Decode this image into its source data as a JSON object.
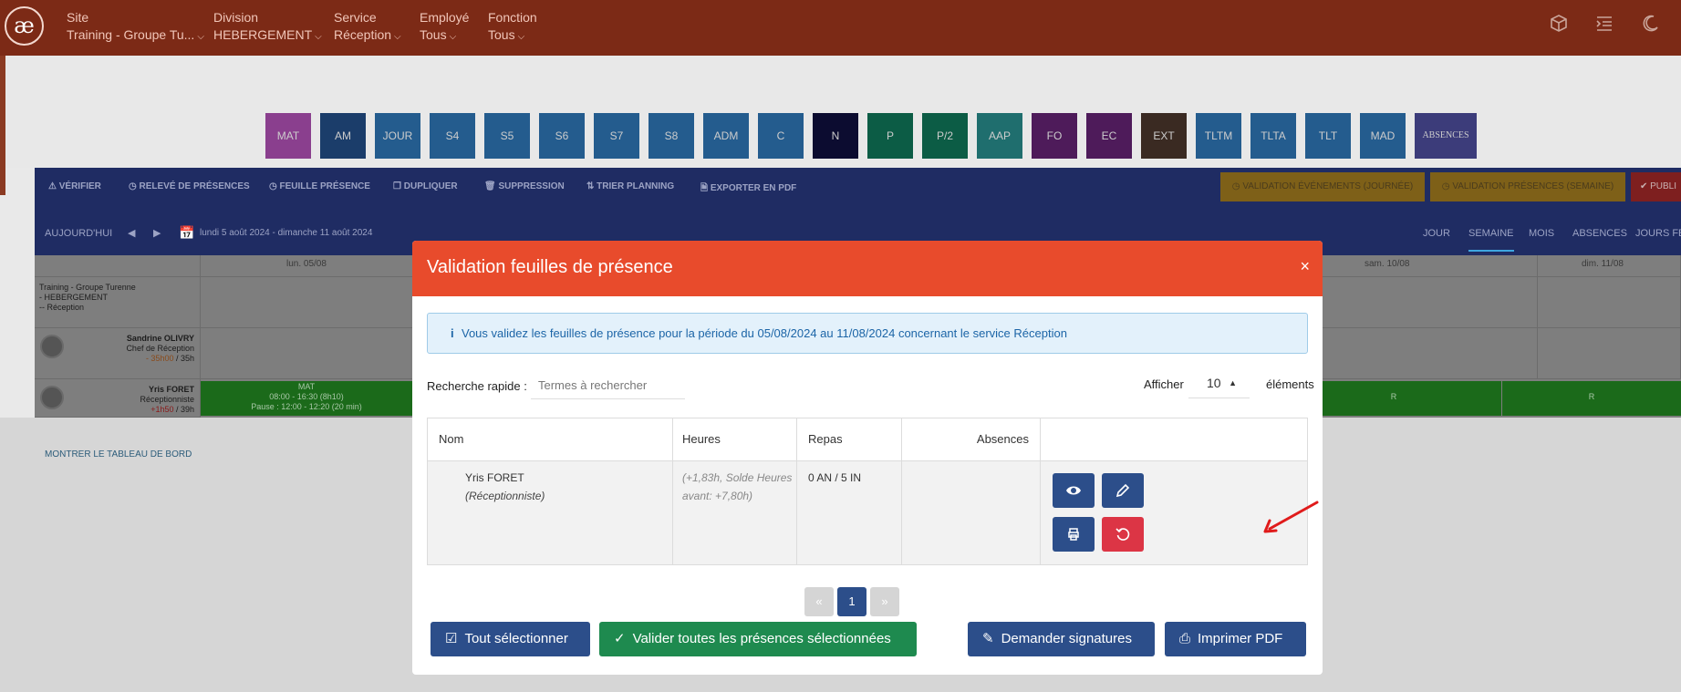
{
  "topbar": {
    "logo": "æ",
    "filters": [
      {
        "label": "Site",
        "value": "Training - Groupe Tu..."
      },
      {
        "label": "Division",
        "value": "HEBERGEMENT"
      },
      {
        "label": "Service",
        "value": "Réception"
      },
      {
        "label": "Employé",
        "value": "Tous"
      },
      {
        "label": "Fonction",
        "value": "Tous"
      }
    ],
    "icons": [
      "cube-icon",
      "indent-icon",
      "moon-icon"
    ]
  },
  "codes": [
    {
      "label": "MAT",
      "color": "#8a3f8e"
    },
    {
      "label": "AM",
      "color": "#1b3d6a"
    },
    {
      "label": "JOUR",
      "color": "#245c8e"
    },
    {
      "label": "S4",
      "color": "#245c8e"
    },
    {
      "label": "S5",
      "color": "#245c8e"
    },
    {
      "label": "S6",
      "color": "#245c8e"
    },
    {
      "label": "S7",
      "color": "#245c8e"
    },
    {
      "label": "S8",
      "color": "#245c8e"
    },
    {
      "label": "ADM",
      "color": "#245c8e"
    },
    {
      "label": "C",
      "color": "#245c8e"
    },
    {
      "label": "N",
      "color": "#0c0c30"
    },
    {
      "label": "P",
      "color": "#0c5c45"
    },
    {
      "label": "P/2",
      "color": "#0c5c45"
    },
    {
      "label": "AAP",
      "color": "#1f6e6e"
    },
    {
      "label": "FO",
      "color": "#4e1b5a"
    },
    {
      "label": "EC",
      "color": "#4e1b5a"
    },
    {
      "label": "EXT",
      "color": "#3a2a22"
    },
    {
      "label": "TLTM",
      "color": "#245c8e"
    },
    {
      "label": "TLTA",
      "color": "#245c8e"
    },
    {
      "label": "TLT",
      "color": "#245c8e"
    },
    {
      "label": "MAD",
      "color": "#245c8e"
    },
    {
      "label": "ABSENCES",
      "color": "#3c3c7a"
    }
  ],
  "actions": [
    "VÉRIFIER",
    "RELEVÉ DE PRÉSENCES",
    "FEUILLE PRÉSENCE",
    "DUPLIQUER",
    "SUPPRESSION",
    "TRIER PLANNING",
    "EXPORTER EN PDF"
  ],
  "action_buttons": [
    "VALIDATION ÉVÉNEMENTS (JOURNÉE)",
    "VALIDATION PRÉSENCES (SEMAINE)",
    "PUBLI"
  ],
  "nav": {
    "today": "AUJOURD'HUI",
    "date_range": "lundi 5 août 2024 - dimanche 11 août 2024",
    "tabs": [
      "JOUR",
      "SEMAINE",
      "MOIS",
      "ABSENCES",
      "JOURS FÉ"
    ]
  },
  "planning": {
    "days": [
      "lun. 05/08",
      "sam. 10/08",
      "dim. 11/08"
    ],
    "group_label": "Training - Groupe Turenne\n- HEBERGEMENT\n-- Réception",
    "employees": [
      {
        "name": "Sandrine OLIVRY",
        "role": "Chef de Réception",
        "hours_delta": "- 35h00",
        "hours_total": " / 35h"
      },
      {
        "name": "Yris FORET",
        "role": "Réceptionniste",
        "hours_delta": "+1h50",
        "hours_total": " / 39h"
      }
    ],
    "shift": {
      "code": "MAT",
      "time": "08:00 - 16:30 (8h10)",
      "pause": "Pause : 12:00 - 12:20 (20 min)"
    },
    "rest_code": "R",
    "dashboard_link": "MONTRER LE TABLEAU DE BORD"
  },
  "modal": {
    "title": "Validation feuilles de présence",
    "close": "×",
    "info": "Vous validez les feuilles de présence pour la période du 05/08/2024 au 11/08/2024 concernant le service Réception",
    "search_label": "Recherche rapide :",
    "search_placeholder": "Termes à rechercher",
    "show_label": "Afficher",
    "show_value": "10",
    "elements_label": "éléments",
    "columns": [
      "Nom",
      "Heures",
      "Repas",
      "Absences"
    ],
    "rows": [
      {
        "name": "Yris FORET",
        "role": "(Réceptionniste)",
        "hours": "(+1,83h, Solde Heures avant: +7,80h)",
        "meals": "0 AN / 5 IN",
        "absences": ""
      }
    ],
    "pager": {
      "prev": "«",
      "current": "1",
      "next": "»"
    },
    "footer": {
      "select_all": "Tout sélectionner",
      "validate_all": "Valider toutes les présences sélectionnées",
      "request_signatures": "Demander signatures",
      "print_pdf": "Imprimer PDF"
    }
  }
}
